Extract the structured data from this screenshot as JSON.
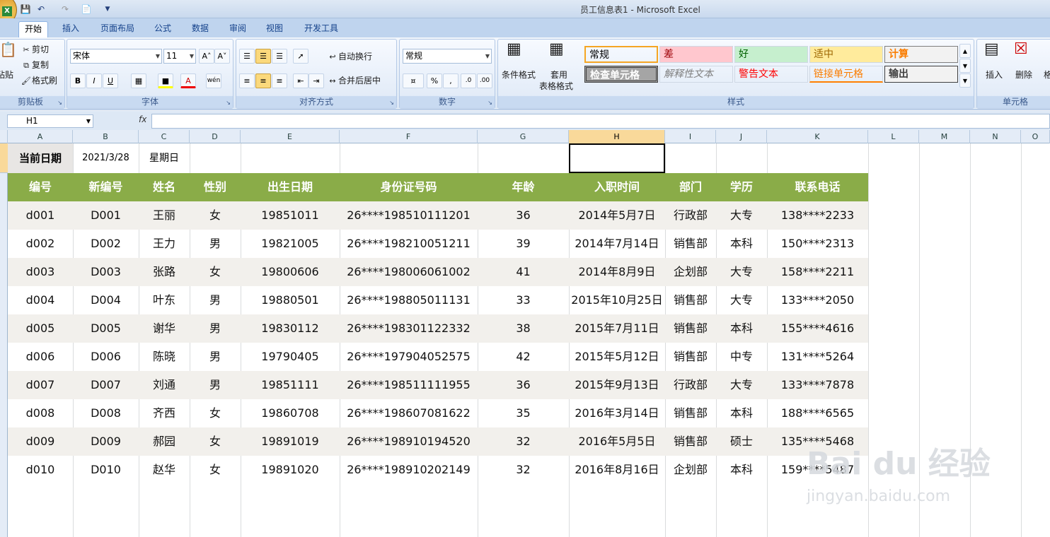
{
  "window": {
    "title": "员工信息表1 - Microsoft Excel"
  },
  "quick_access": [
    "save-icon",
    "undo-icon",
    "redo-icon",
    "print-preview-icon"
  ],
  "tabs": [
    "开始",
    "插入",
    "页面布局",
    "公式",
    "数据",
    "审阅",
    "视图",
    "开发工具"
  ],
  "ribbon": {
    "clipboard": {
      "label": "剪贴板",
      "paste": "粘贴",
      "cut": "剪切",
      "copy": "复制",
      "format_painter": "格式刷"
    },
    "font": {
      "label": "字体",
      "font_name": "宋体",
      "font_size": "11",
      "bold": "B",
      "italic": "I",
      "underline": "U",
      "wen": "wén"
    },
    "alignment": {
      "label": "对齐方式",
      "wrap": "自动换行",
      "merge": "合并后居中"
    },
    "number": {
      "label": "数字",
      "format": "常规",
      "percent": "%",
      "comma": ","
    },
    "styles": {
      "label": "样式",
      "conditional": "条件格式",
      "table_format_1": "套用",
      "table_format_2": "表格格式",
      "cells": [
        {
          "text": "常规",
          "bg": "#ffffff",
          "color": "#000000"
        },
        {
          "text": "差",
          "bg": "#ffc7ce",
          "color": "#9c0006"
        },
        {
          "text": "好",
          "bg": "#c6efce",
          "color": "#006100"
        },
        {
          "text": "适中",
          "bg": "#ffeb9c",
          "color": "#9c6500"
        },
        {
          "text": "计算",
          "bg": "#f2f2f2",
          "color": "#fa7d00"
        },
        {
          "text": "检查单元格",
          "bg": "#a5a5a5",
          "color": "#ffffff"
        },
        {
          "text": "解释性文本",
          "bg": "#ffffff",
          "color": "#7f7f7f"
        },
        {
          "text": "警告文本",
          "bg": "#ffffff",
          "color": "#ff0000"
        },
        {
          "text": "链接单元格",
          "bg": "#ffffff",
          "color": "#fa7d00"
        },
        {
          "text": "输出",
          "bg": "#f2f2f2",
          "color": "#3f3f3f"
        }
      ]
    },
    "cells_group": {
      "label": "单元格",
      "insert": "插入",
      "delete": "删除",
      "format": "格"
    }
  },
  "formula_bar": {
    "name_box": "H1",
    "fx": "fx",
    "value": ""
  },
  "columns": [
    "A",
    "B",
    "C",
    "D",
    "E",
    "F",
    "G",
    "H",
    "I",
    "J",
    "K",
    "L",
    "M",
    "N",
    "O"
  ],
  "selected_column": "H",
  "sheet": {
    "row1": {
      "label": "当前日期",
      "date": "2021/3/28",
      "weekday": "星期日"
    },
    "headers": [
      "编号",
      "新编号",
      "姓名",
      "性别",
      "出生日期",
      "身份证号码",
      "年龄",
      "入职时间",
      "部门",
      "学历",
      "联系电话"
    ],
    "rows": [
      [
        "d001",
        "D001",
        "王丽",
        "女",
        "19851011",
        "26****198510111201",
        "36",
        "2014年5月7日",
        "行政部",
        "大专",
        "138****2233"
      ],
      [
        "d002",
        "D002",
        "王力",
        "男",
        "19821005",
        "26****198210051211",
        "39",
        "2014年7月14日",
        "销售部",
        "本科",
        "150****2313"
      ],
      [
        "d003",
        "D003",
        "张路",
        "女",
        "19800606",
        "26****198006061002",
        "41",
        "2014年8月9日",
        "企划部",
        "大专",
        "158****2211"
      ],
      [
        "d004",
        "D004",
        "叶东",
        "男",
        "19880501",
        "26****198805011131",
        "33",
        "2015年10月25日",
        "销售部",
        "大专",
        "133****2050"
      ],
      [
        "d005",
        "D005",
        "谢华",
        "男",
        "19830112",
        "26****198301122332",
        "38",
        "2015年7月11日",
        "销售部",
        "本科",
        "155****4616"
      ],
      [
        "d006",
        "D006",
        "陈晓",
        "男",
        "19790405",
        "26****197904052575",
        "42",
        "2015年5月12日",
        "销售部",
        "中专",
        "131****5264"
      ],
      [
        "d007",
        "D007",
        "刘通",
        "男",
        "19851111",
        "26****198511111955",
        "36",
        "2015年9月13日",
        "行政部",
        "大专",
        "133****7878"
      ],
      [
        "d008",
        "D008",
        "齐西",
        "女",
        "19860708",
        "26****198607081622",
        "35",
        "2016年3月14日",
        "销售部",
        "本科",
        "188****6565"
      ],
      [
        "d009",
        "D009",
        "郝园",
        "女",
        "19891019",
        "26****198910194520",
        "32",
        "2016年5月5日",
        "销售部",
        "硕士",
        "135****5468"
      ],
      [
        "d010",
        "D010",
        "赵华",
        "女",
        "19891020",
        "26****198910202149",
        "32",
        "2016年8月16日",
        "企划部",
        "本科",
        "159****5487"
      ]
    ],
    "header_color": "#8aac48",
    "even_row_color": "#f2f0ec"
  },
  "watermark": {
    "logo": "Bai du 经验",
    "url": "jingyan.baidu.com"
  }
}
